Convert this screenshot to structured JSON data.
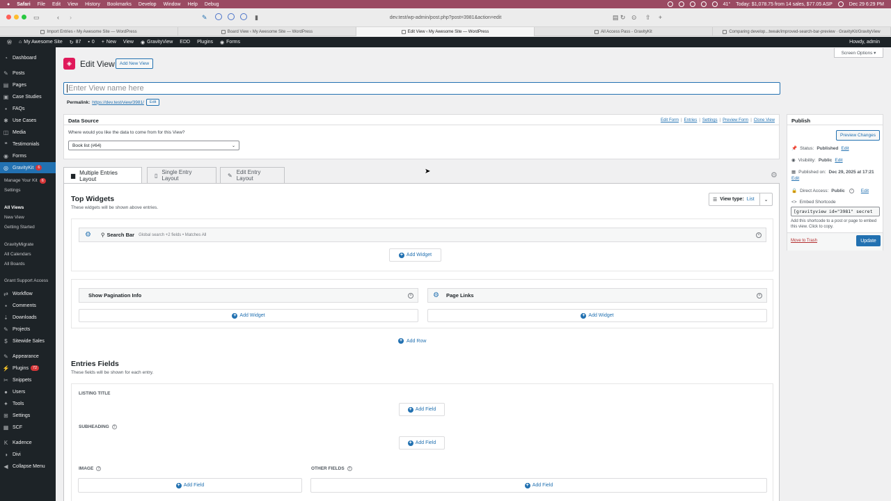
{
  "mac_menu": {
    "apple": "",
    "items": [
      "Safari",
      "File",
      "Edit",
      "View",
      "History",
      "Bookmarks",
      "Develop",
      "Window",
      "Help",
      "Debug"
    ],
    "status": "Today: $1,078.75 from 14 sales, $77.05 ASP",
    "temp": "41°",
    "datetime": "Dec 29  6:29 PM"
  },
  "browser": {
    "url": "dev.test/wp-admin/post.php?post=3981&action=edit",
    "tabs": [
      "Import Entries ‹ My Awesome Site — WordPress",
      "Board View ‹ My Awesome Site — WordPress",
      "Edit View ‹ My Awesome Site — WordPress",
      "All Access Pass - GravityKit",
      "Comparing develop...tweak/improved-search-bar-preview · GravityKit/GravityView"
    ]
  },
  "adminbar": {
    "site": "My Awesome Site",
    "updates": "87",
    "comments": "0",
    "new": "New",
    "view": "View",
    "gravityview": "GravityView",
    "edd": "EDD",
    "plugins": "Plugins",
    "forms": "Forms",
    "howdy": "Howdy, admin"
  },
  "sidebar": {
    "dashboard": "Dashboard",
    "posts": "Posts",
    "pages": "Pages",
    "case_studies": "Case Studies",
    "faqs": "FAQs",
    "use_cases": "Use Cases",
    "media": "Media",
    "testimonials": "Testimonials",
    "forms": "Forms",
    "gravitykit": "GravityKit",
    "gravitykit_badge": "6",
    "manage_kit": "Manage Your Kit",
    "manage_kit_badge": "6",
    "settings_sub": "Settings",
    "all_views": "All Views",
    "new_view": "New View",
    "getting_started": "Getting Started",
    "gravitymigrate": "GravityMigrate",
    "all_calendars": "All Calendars",
    "all_boards": "All Boards",
    "grant_support": "Grant Support Access",
    "workflow": "Workflow",
    "comments": "Comments",
    "downloads": "Downloads",
    "projects": "Projects",
    "sitewide_sales": "Sitewide Sales",
    "appearance": "Appearance",
    "plugins": "Plugins",
    "plugins_badge": "72",
    "snippets": "Snippets",
    "users": "Users",
    "tools": "Tools",
    "settings": "Settings",
    "scf": "SCF",
    "kadence": "Kadence",
    "divi": "Divi",
    "collapse": "Collapse Menu"
  },
  "page": {
    "title": "Edit View",
    "add_new": "Add New View",
    "screen_options": "Screen Options ▾",
    "name_placeholder": "Enter View name here",
    "permalink_label": "Permalink:",
    "permalink_url": "https://dev.test/view/3981/",
    "permalink_edit": "Edit"
  },
  "data_source": {
    "title": "Data Source",
    "question": "Where would you like the data to come from for this View?",
    "selected": "Book list (#64)",
    "links": [
      "Edit Form",
      "Entries",
      "Settings",
      "Preview Form",
      "Clone View"
    ]
  },
  "layouts": {
    "multiple": "Multiple Entries Layout",
    "single": "Single Entry Layout",
    "edit": "Edit Entry Layout"
  },
  "top_widgets": {
    "title": "Top Widgets",
    "desc": "These widgets will be shown above entries.",
    "view_type_label": "View type:",
    "view_type_value": "List",
    "search_bar": "Search Bar",
    "search_bar_meta": "Global search +2 fields • Matches All",
    "add_widget": "Add Widget",
    "pagination": "Show Pagination Info",
    "page_links": "Page Links",
    "add_row": "Add Row"
  },
  "entries_fields": {
    "title": "Entries Fields",
    "desc": "These fields will be shown for each entry.",
    "listing_title": "LISTING TITLE",
    "subheading": "SUBHEADING",
    "image": "IMAGE",
    "other_fields": "OTHER FIELDS",
    "add_field": "Add Field"
  },
  "publish": {
    "title": "Publish",
    "preview": "Preview Changes",
    "status_label": "Status:",
    "status_value": "Published",
    "visibility_label": "Visibility:",
    "visibility_value": "Public",
    "published_label": "Published on:",
    "published_value": "Dec 29, 2025 at 17:21",
    "direct_access_label": "Direct Access:",
    "direct_access_value": "Public",
    "edit": "Edit",
    "embed_label": "Embed Shortcode",
    "shortcode": "[gravityview id=\"3981\" secret",
    "embed_help": "Add this shortcode to a post or page to embed this view. Click to copy.",
    "trash": "Move to Trash",
    "update": "Update"
  },
  "colors": {
    "accent": "#2271b1",
    "admin_dark": "#1d2327",
    "gravitykit_pink": "#e0195a",
    "mac_bar": "#9a4a62"
  }
}
